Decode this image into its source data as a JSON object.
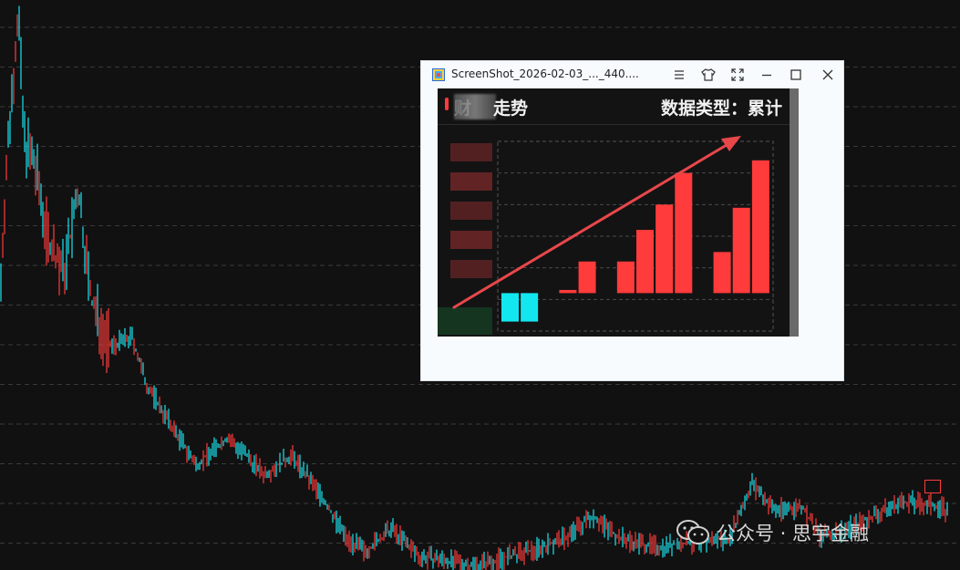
{
  "window": {
    "title": "ScreenShot_2026-02-03_..._440....",
    "controls": [
      "menu-icon",
      "pin-icon",
      "fullscreen-icon",
      "minimize-icon",
      "maximize-icon",
      "close-icon"
    ]
  },
  "inner": {
    "title_first_char": "财",
    "title_rest": "走势",
    "data_type_label": "数据类型：累计",
    "accent_color": "#ff3b3b",
    "negative_color": "#12e7f0"
  },
  "chart_data": {
    "type": "bar",
    "title": "",
    "categories": [
      "",
      "",
      "",
      "",
      "",
      "",
      "",
      "",
      "",
      "",
      "",
      "",
      "",
      "",
      ""
    ],
    "values": [
      -9,
      -9,
      0,
      1,
      10,
      0,
      10,
      20,
      28,
      38,
      0,
      13,
      27,
      42
    ],
    "ylim": [
      -12,
      48
    ],
    "grid": true,
    "trend_arrow": true,
    "colors": {
      "positive": "#ff3b3b",
      "negative": "#12e7f0"
    }
  },
  "watermark": {
    "text": "公众号 · 思宇金融"
  },
  "background": {
    "series_colors": {
      "up": "#ff3b3b",
      "down": "#19e6ee"
    },
    "grid_color": "#3a3a3c"
  }
}
